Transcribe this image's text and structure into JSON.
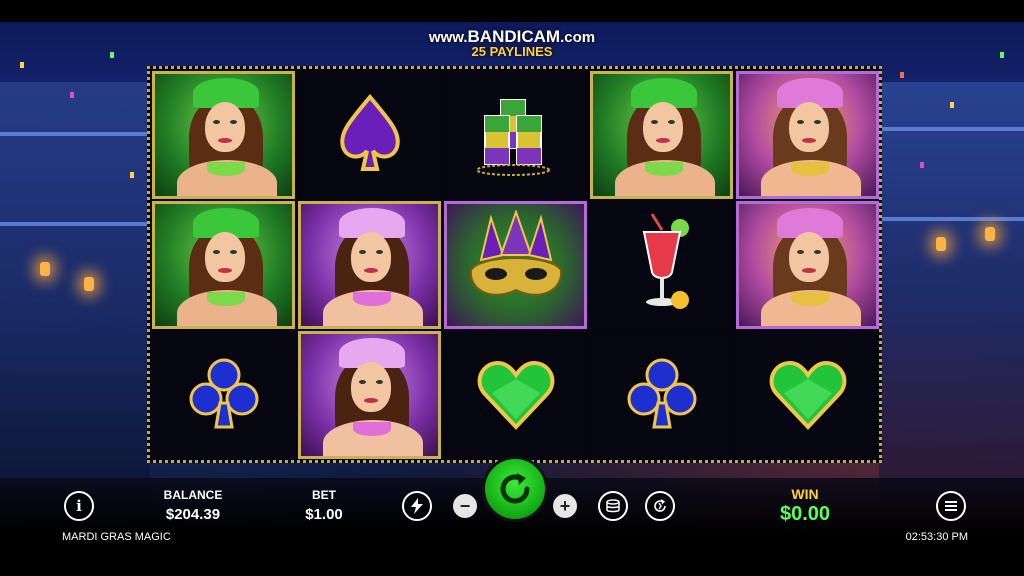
{
  "watermark": {
    "prefix": "www.",
    "brand": "BANDICAM",
    "suffix": ".com"
  },
  "paylines_label": "25 PAYLINES",
  "grid": {
    "rows": [
      [
        "green-dancer",
        "purple-spade",
        "shot-glasses",
        "green-dancer",
        "orange-dancer"
      ],
      [
        "green-dancer",
        "purple-dancer",
        "mardi-gras-mask",
        "red-cocktail",
        "orange-dancer"
      ],
      [
        "blue-club",
        "purple-dancer",
        "green-heart",
        "blue-club",
        "green-heart"
      ]
    ]
  },
  "controls": {
    "info_label": "i",
    "balance_label": "BALANCE",
    "balance_value": "$204.39",
    "bet_label": "BET",
    "bet_value": "$1.00",
    "minus_label": "−",
    "plus_label": "+",
    "win_label": "WIN",
    "win_value": "$0.00"
  },
  "footer": {
    "game_name": "MARDI GRAS MAGIC",
    "time": "02:53:30 PM"
  },
  "colors": {
    "spin": "#17b418",
    "win": "#5cff5c",
    "paylines": "#ffd43a",
    "frame": "#c8a94a"
  }
}
